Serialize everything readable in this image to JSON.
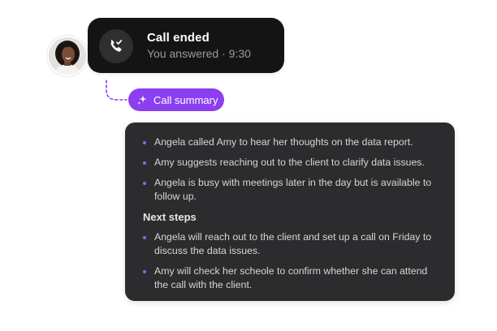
{
  "call": {
    "title": "Call ended",
    "subtitle": "You answered · 9:30",
    "icon": "phone-check-icon"
  },
  "avatar": {
    "icon": "avatar"
  },
  "summary_button": {
    "label": "Call summary",
    "icon": "sparkle-icon"
  },
  "summary": {
    "items": [
      {
        "text": "Angela called Amy to hear her thoughts on the data report."
      },
      {
        "text": "Amy suggests reaching out to the client to clarify data issues."
      },
      {
        "text": "Angela is busy with meetings later in the day but is available to follow up."
      }
    ],
    "next_steps_heading": "Next steps",
    "next_steps": [
      {
        "text": "Angela will reach out to the client and set up a call on Friday to discuss the data issues."
      },
      {
        "text": "Amy will check her scheole to confirm whether she can attend the call with the client."
      }
    ]
  },
  "colors": {
    "card_background": "#141414",
    "panel_background": "#2c2c2e",
    "accent_purple": "#8b3ff0",
    "bullet_purple": "#9b5cf2"
  }
}
